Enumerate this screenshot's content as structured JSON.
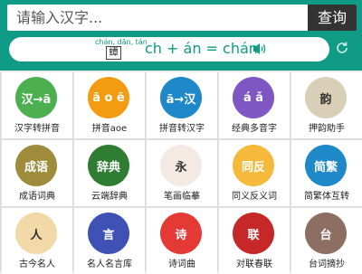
{
  "search": {
    "placeholder": "请输入汉字...",
    "button_label": "查询"
  },
  "pinyin": {
    "small_text": "chán, dān, tán",
    "box_char": "蟫",
    "formula": "ch + án = chán"
  },
  "icons": {
    "speaker": "speaker-icon",
    "refresh": "refresh-icon"
  },
  "colors": {
    "brand": "#0f9b86"
  },
  "grid": [
    {
      "label": "汉字转拼音",
      "icon": "hanzi-to-pinyin-icon",
      "color": "#4caf50",
      "glyph": "汉→ā"
    },
    {
      "label": "拼音aoe",
      "icon": "pinyin-aoe-icon",
      "color": "#f39c12",
      "glyph": "ā o ē"
    },
    {
      "label": "拼音转汉字",
      "icon": "pinyin-to-hanzi-icon",
      "color": "#1e88c8",
      "glyph": "ā→汉"
    },
    {
      "label": "经典多音字",
      "icon": "polyphonic-icon",
      "color": "#7e57c2",
      "glyph": "á ǎ"
    },
    {
      "label": "押韵助手",
      "icon": "rhyme-helper-icon",
      "color": "#d9cfb7",
      "glyph": "韵"
    },
    {
      "label": "成语词典",
      "icon": "idiom-dictionary-icon",
      "color": "#9e8c3a",
      "glyph": "成语"
    },
    {
      "label": "云端辞典",
      "icon": "cloud-dictionary-icon",
      "color": "#2e7d32",
      "glyph": "辞典"
    },
    {
      "label": "笔画临摹",
      "icon": "stroke-copy-icon",
      "color": "#f5e9e4",
      "glyph": "永"
    },
    {
      "label": "同义反义词",
      "icon": "synonym-antonym-icon",
      "color": "#f6b93b",
      "glyph": "同反"
    },
    {
      "label": "简繁体互转",
      "icon": "simplified-traditional-icon",
      "color": "#1e88c8",
      "glyph": "简繁"
    },
    {
      "label": "古今名人",
      "icon": "famous-people-icon",
      "color": "#f1d9a8",
      "glyph": "人"
    },
    {
      "label": "名人名言库",
      "icon": "quotes-icon",
      "color": "#3f51b5",
      "glyph": "言"
    },
    {
      "label": "诗词曲",
      "icon": "poetry-icon",
      "color": "#e53935",
      "glyph": "诗"
    },
    {
      "label": "对联春联",
      "icon": "couplet-icon",
      "color": "#c62828",
      "glyph": "联"
    },
    {
      "label": "台词摘抄",
      "icon": "film-lines-icon",
      "color": "#8d6e63",
      "glyph": "台"
    }
  ]
}
